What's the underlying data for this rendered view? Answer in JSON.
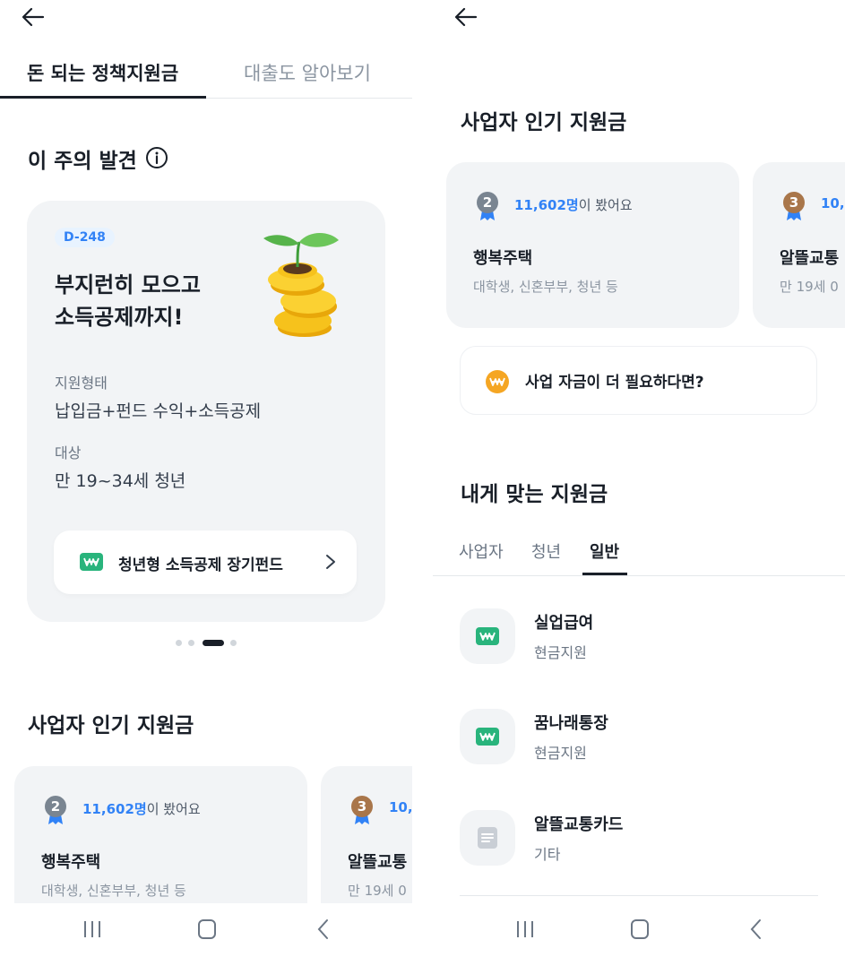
{
  "colors": {
    "accent_blue": "#3182f6",
    "green_badge": "#29b47c",
    "coin_orange": "#f5a623",
    "card_bg": "#f2f4f6",
    "silver_medal": "#7a8591",
    "bronze_medal": "#a9764a"
  },
  "left": {
    "tabs": [
      {
        "label": "돈 되는 정책지원금",
        "active": true
      },
      {
        "label": "대출도 알아보기",
        "active": false
      }
    ],
    "section_title": "이 주의 발견",
    "feature": {
      "dday": "D-248",
      "headline_line1": "부지런히 모으고",
      "headline_line2": "소득공제까지!",
      "support_type_label": "지원형태",
      "support_type_value": "납입금+펀드 수익+소득공제",
      "target_label": "대상",
      "target_value": "만 19~34세 청년",
      "button_label": "청년형 소득공제 장기펀드",
      "illustration": "coin-sprout-icon"
    },
    "carousel": {
      "total": 4,
      "active_index": 2
    },
    "popular_title": "사업자 인기 지원금",
    "popular": [
      {
        "rank": "2",
        "views_num": "11,602명",
        "views_suffix": "이 봤어요",
        "name": "행복주택",
        "sub": "대학생, 신혼부부, 청년 등"
      },
      {
        "rank": "3",
        "views_num": "10,",
        "views_suffix": "",
        "name": "알뜰교통",
        "sub": "만 19세 0"
      }
    ]
  },
  "right": {
    "popular_title": "사업자 인기 지원금",
    "popular": [
      {
        "rank": "2",
        "views_num": "11,602명",
        "views_suffix": "이 봤어요",
        "name": "행복주택",
        "sub": "대학생, 신혼부부, 청년 등"
      },
      {
        "rank": "3",
        "views_num": "10,",
        "views_suffix": "",
        "name": "알뜰교통",
        "sub": "만 19세 0"
      }
    ],
    "fund_button": "사업 자금이 더 필요하다면?",
    "match_title": "내게 맞는 지원금",
    "subtabs": [
      {
        "label": "사업자",
        "active": false
      },
      {
        "label": "청년",
        "active": false
      },
      {
        "label": "일반",
        "active": true
      }
    ],
    "list": [
      {
        "title": "실업급여",
        "sub": "현금지원",
        "icon": "won-badge-icon"
      },
      {
        "title": "꿈나래통장",
        "sub": "현금지원",
        "icon": "won-badge-icon"
      },
      {
        "title": "알뜰교통카드",
        "sub": "기타",
        "icon": "document-icon"
      }
    ]
  },
  "navbar": {
    "icons": [
      "recent-apps-icon",
      "home-icon",
      "back-icon"
    ]
  }
}
